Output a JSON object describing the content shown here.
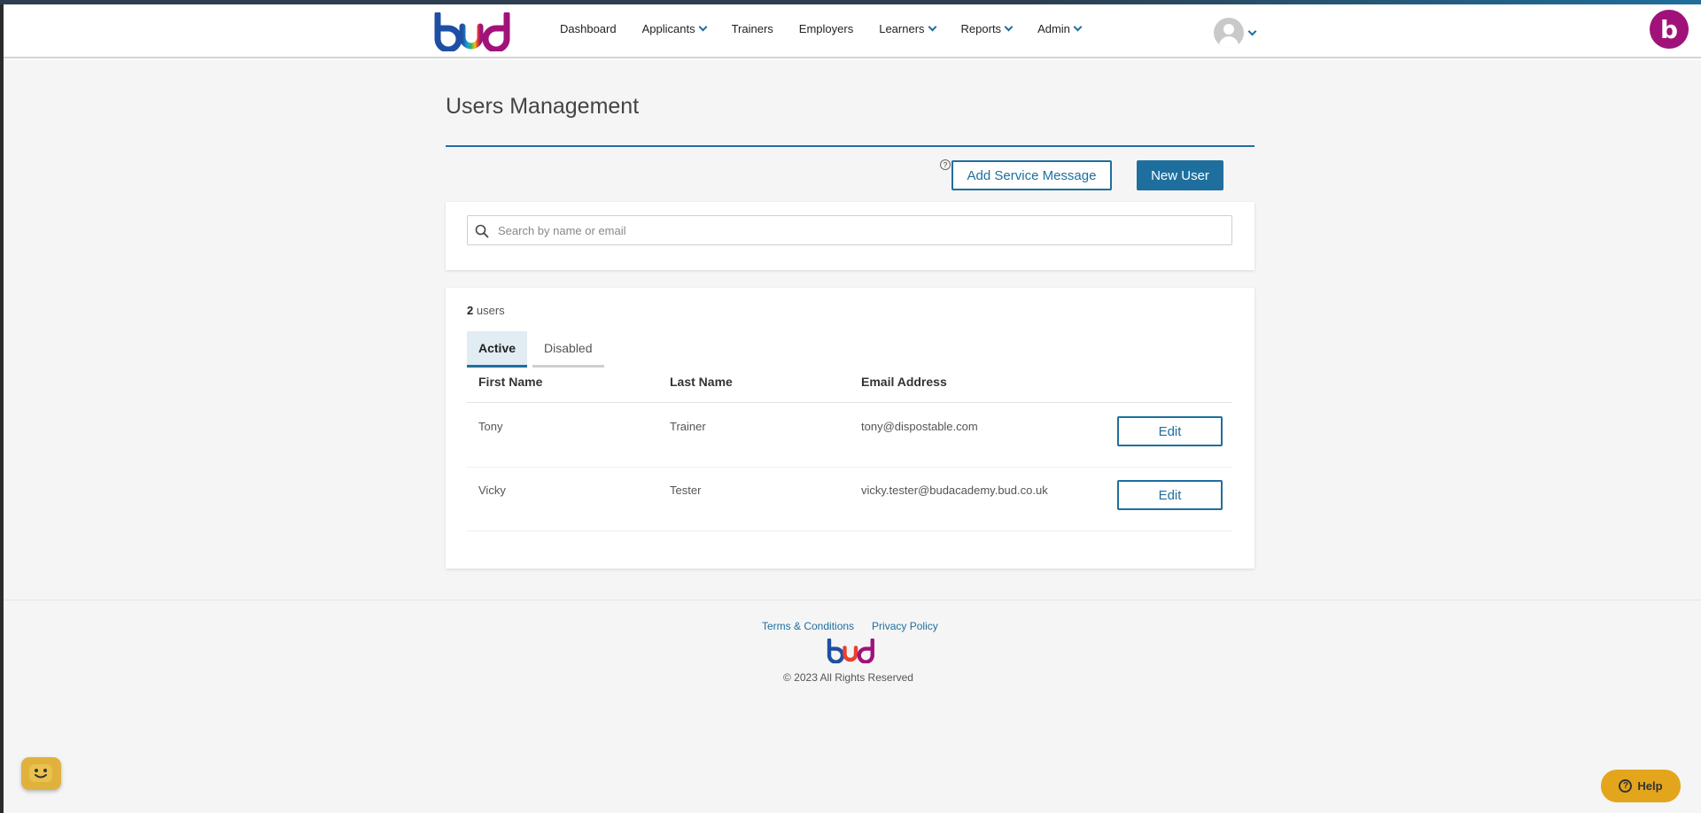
{
  "header": {
    "logo_text": "bud",
    "nav": [
      {
        "label": "Dashboard",
        "has_dropdown": false
      },
      {
        "label": "Applicants",
        "has_dropdown": true
      },
      {
        "label": "Trainers",
        "has_dropdown": false
      },
      {
        "label": "Employers",
        "has_dropdown": false
      },
      {
        "label": "Learners",
        "has_dropdown": true
      },
      {
        "label": "Reports",
        "has_dropdown": true
      },
      {
        "label": "Admin",
        "has_dropdown": true
      }
    ],
    "brand_badge": "b"
  },
  "page": {
    "title": "Users Management",
    "help_marker": "?",
    "add_service_message_label": "Add Service Message",
    "new_user_label": "New User"
  },
  "search": {
    "placeholder": "Search by name or email",
    "value": ""
  },
  "users": {
    "count": "2",
    "count_label": "users",
    "tabs": [
      {
        "label": "Active",
        "selected": true
      },
      {
        "label": "Disabled",
        "selected": false
      }
    ],
    "columns": [
      "First Name",
      "Last Name",
      "Email Address"
    ],
    "rows": [
      {
        "first_name": "Tony",
        "last_name": "Trainer",
        "email": "tony@dispostable.com",
        "action": "Edit"
      },
      {
        "first_name": "Vicky",
        "last_name": "Tester",
        "email": "vicky.tester@budacademy.bud.co.uk",
        "action": "Edit"
      }
    ]
  },
  "footer": {
    "terms_label": "Terms & Conditions",
    "privacy_label": "Privacy Policy",
    "copyright": "© 2023 All Rights Reserved"
  },
  "widgets": {
    "help_label": "Help"
  },
  "colors": {
    "primary": "#1f6f9e",
    "brand_badge": "#a0127a",
    "help_button": "#e3a51b",
    "chat_button": "#e0b13c"
  }
}
